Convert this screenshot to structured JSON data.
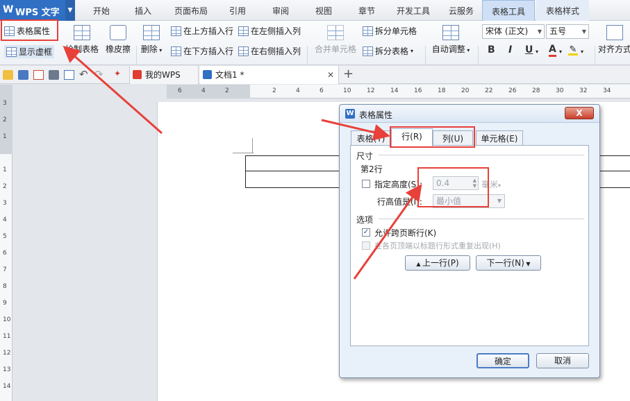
{
  "app": {
    "name": "WPS 文字",
    "logo": "W"
  },
  "menu_tabs": [
    "开始",
    "插入",
    "页面布局",
    "引用",
    "审阅",
    "视图",
    "章节",
    "开发工具",
    "云服务",
    "表格工具",
    "表格样式"
  ],
  "active_menu_tab": "表格工具",
  "ribbon": {
    "table_props": "表格属性",
    "show_grid": "显示虚框",
    "draw_table": "绘制表格",
    "eraser": "橡皮擦",
    "delete": "删除",
    "insert_above": "在上方插入行",
    "insert_below": "在下方插入行",
    "insert_left": "在左侧插入列",
    "insert_right": "在右侧插入列",
    "merge_cells": "合并单元格",
    "split_cells": "拆分单元格",
    "split_table": "拆分表格",
    "auto_fit": "自动调整",
    "font_name": "宋体 (正文)",
    "font_size": "五号",
    "bold": "B",
    "italic": "I",
    "underline": "U",
    "font_color": "A",
    "align": "对齐方式"
  },
  "doc_tabs": {
    "home": "我的WPS",
    "doc": "文档1 *",
    "new": "+"
  },
  "ruler_h": [
    "6",
    "4",
    "2",
    "",
    "2",
    "4",
    "6",
    "10",
    "12",
    "14",
    "16",
    "18",
    "20",
    "22",
    "26",
    "28",
    "30",
    "32",
    "34"
  ],
  "ruler_v": [
    "3",
    "2",
    "1",
    "",
    "1",
    "2",
    "3",
    "4",
    "5",
    "6",
    "7",
    "8",
    "9",
    "10",
    "11",
    "12",
    "13",
    "14"
  ],
  "dialog": {
    "title": "表格属性",
    "close": "X",
    "tabs": [
      "表格(T)",
      "行(R)",
      "列(U)",
      "单元格(E)"
    ],
    "active_tab": "行(R)",
    "size_section": "尺寸",
    "row_label": "第2行",
    "specify_height": "指定高度(S):",
    "height_value": "0.4",
    "height_unit": "毫米",
    "row_height_is": "行高值是(I):",
    "row_height_mode": "最小值",
    "options_section": "选项",
    "allow_break": "允许跨页断行(K)",
    "allow_break_checked": true,
    "repeat_header": "在各页顶端以标题行形式重复出现(H)",
    "prev_row": "上一行(P)",
    "next_row": "下一行(N)",
    "ok": "确定",
    "cancel": "取消"
  },
  "colors": {
    "highlight": "#e8403a",
    "app_blue": "#2f6fc4",
    "active_tab_bg": "#cfe0f6"
  }
}
